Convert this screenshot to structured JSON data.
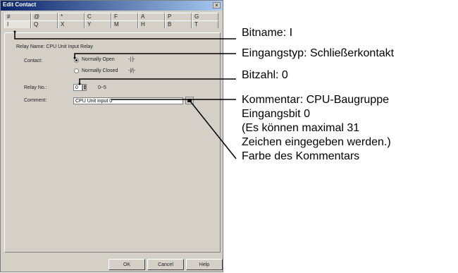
{
  "dialog": {
    "title": "Edit Contact",
    "close_glyph": "×",
    "tabs_row1": [
      "#",
      "@",
      "*",
      "C",
      "F",
      "A",
      "P",
      "G"
    ],
    "tabs_row2": [
      "I",
      "Q",
      "X",
      "Y",
      "M",
      "H",
      "B",
      "T"
    ],
    "relay_name": "Relay Name: CPU Unit Input Relay",
    "contact_label": "Contact:",
    "normally_open": "Normally Open",
    "normally_closed": "Normally Closed",
    "no_symbol": "-|├",
    "nc_symbol": "-|/|-",
    "relay_no_label": "Relay No.:",
    "relay_no_value": "0",
    "relay_range": "0~5",
    "comment_label": "Comment:",
    "comment_value": "CPU Unit input 0",
    "ok": "OK",
    "cancel": "Cancel",
    "help": "Help"
  },
  "callouts": {
    "bitname": "Bitname: I",
    "eingangstyp": "Eingangstyp: Schließerkontakt",
    "bitzahl": "Bitzahl: 0",
    "kommentar_line1": "Kommentar: CPU-Baugruppe",
    "kommentar_line2": "Eingangsbit 0",
    "kommentar_line3": "(Es können maximal 31",
    "kommentar_line4": "Zeichen eingegeben werden.)",
    "farbe": "Farbe des Kommentars"
  }
}
